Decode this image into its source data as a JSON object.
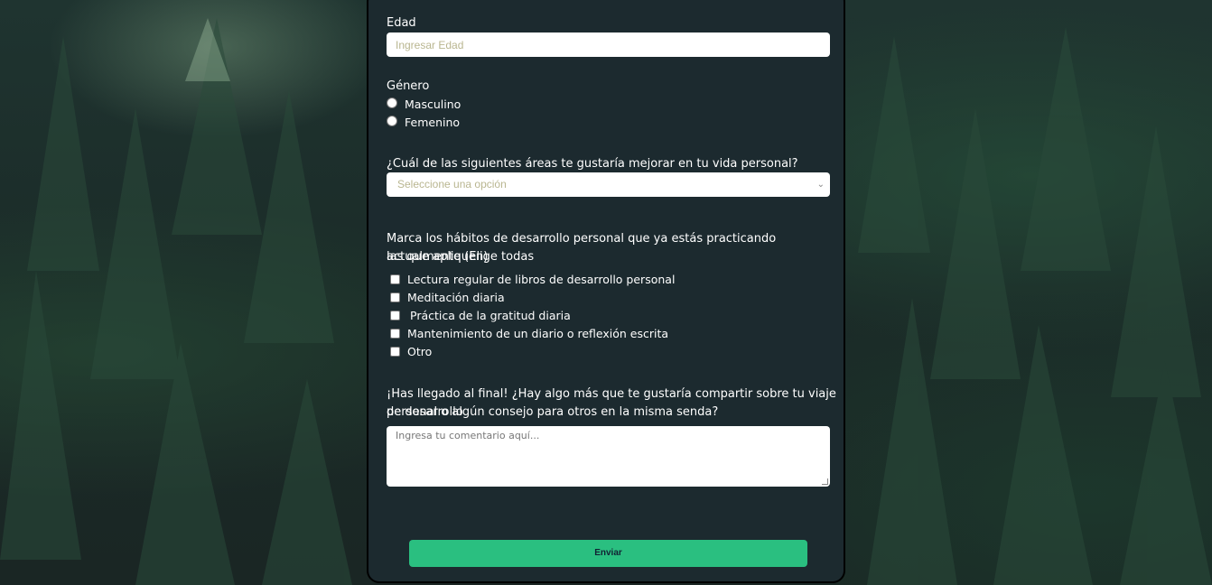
{
  "form": {
    "age": {
      "label": "Edad",
      "placeholder": "Ingresar Edad"
    },
    "gender": {
      "label": "Género",
      "options": [
        "Masculino",
        "Femenino"
      ]
    },
    "area": {
      "label": "¿Cuál de las siguientes áreas te gustaría mejorar en tu vida personal?",
      "selected": "Seleccione una opción"
    },
    "habits": {
      "label_line1": "Marca los hábitos de desarrollo personal que ya estás practicando actualmente (Elige todas",
      "label_line2": "las que apliquen)",
      "options": [
        "Lectura regular de libros de desarrollo personal",
        "Meditación diaria",
        "Práctica de la gratitud diaria",
        "Mantenimiento de un diario o reflexión escrita",
        "Otro"
      ]
    },
    "comment": {
      "label_line1": "¡Has llegado al final! ¿Hay algo más que te gustaría compartir sobre tu viaje de desarrollo",
      "label_line2": "personal o algún consejo para otros en la misma senda?",
      "placeholder": "Ingresa tu comentario aquí..."
    },
    "submit_label": "Enviar"
  },
  "colors": {
    "card_bg": "#1c2a2f",
    "button": "#2abf80",
    "placeholder": "#b9b690"
  }
}
